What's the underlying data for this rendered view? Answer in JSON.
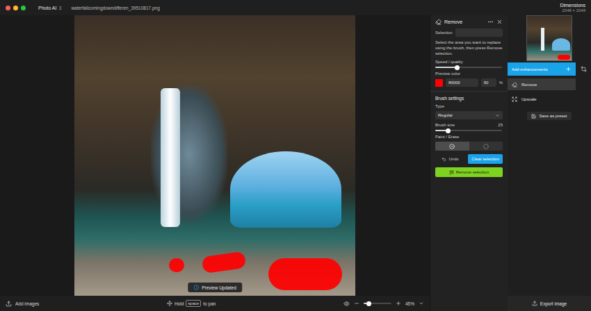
{
  "app": {
    "name": "Photo AI",
    "version": "3",
    "filename": "waterfallcomingdowndifferen_39510817.png"
  },
  "dimensions": {
    "label": "Dimensions",
    "value": "2048 × 2048"
  },
  "toast": {
    "text": "Preview Updated"
  },
  "bottom_bar": {
    "add_images": "Add images",
    "hint_prefix": "Hold",
    "hint_key": "space",
    "hint_suffix": "to pan",
    "zoom": "45%",
    "zoom_level": 0.2
  },
  "remove_panel": {
    "title": "Remove",
    "selection_label": "Selection",
    "description": "Select the area you want to replace using the brush, then press Remove selection.",
    "speed": {
      "label": "Speed / quality",
      "level": 0.33
    },
    "preview_color": {
      "label": "Preview color",
      "hex": "ff0000",
      "color": "#ff0000",
      "opacity": "50",
      "unit": "%"
    },
    "brush_settings": "Brush settings",
    "type": {
      "label": "Type",
      "value": "Regular"
    },
    "brush_size": {
      "label": "Brush size",
      "value": "25",
      "level": 0.19
    },
    "paint_erase": {
      "label": "Paint / Erase",
      "modes": [
        {
          "mode": "paint",
          "selected": true
        },
        {
          "mode": "erase",
          "selected": false
        }
      ]
    },
    "undo": "Undo",
    "clear": "Clear selection",
    "remove": "Remove selection"
  },
  "sidebar": {
    "add": "Add enhancements",
    "items": [
      {
        "label": "Remove",
        "selected": true
      },
      {
        "label": "Upscale",
        "selected": false
      }
    ],
    "preset": "Save as preset",
    "export": "Export image"
  }
}
